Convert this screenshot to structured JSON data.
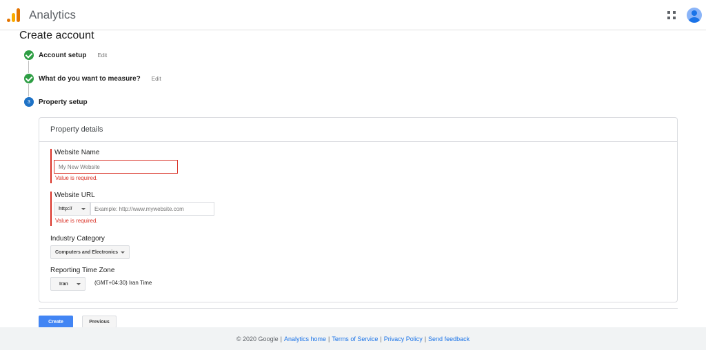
{
  "header": {
    "app_title": "Analytics",
    "logo_icon": "analytics-logo-icon",
    "apps_icon": "apps-grid-icon",
    "avatar_icon": "account-avatar-icon",
    "logo_colors": [
      "#e37400",
      "#f9ab00"
    ]
  },
  "page": {
    "title": "Create account"
  },
  "stepper": {
    "steps": [
      {
        "label": "Account setup",
        "edit": "Edit",
        "state": "complete"
      },
      {
        "label": "What do you want to measure?",
        "edit": "Edit",
        "state": "complete"
      },
      {
        "label": "Property setup",
        "number": "3",
        "state": "active"
      }
    ],
    "colors": {
      "complete": "#2e9e44",
      "active": "#1e72c6"
    }
  },
  "form": {
    "card_title": "Property details",
    "website_name": {
      "label": "Website Name",
      "placeholder": "My New Website",
      "error": "Value is required."
    },
    "website_url": {
      "label": "Website URL",
      "protocol": "http://",
      "placeholder": "Example: http://www.mywebsite.com",
      "error": "Value is required."
    },
    "industry": {
      "label": "Industry Category",
      "selected": "Computers and Electronics"
    },
    "timezone": {
      "label": "Reporting Time Zone",
      "country": "Iran",
      "zone_text": "(GMT+04:30) Iran Time"
    },
    "error_color": "#d93025"
  },
  "actions": {
    "create": "Create",
    "previous": "Previous",
    "primary_color": "#4285f4"
  },
  "footer": {
    "copyright": "© 2020 Google",
    "links": [
      "Analytics home",
      "Terms of Service",
      "Privacy Policy",
      "Send feedback"
    ],
    "separator": "|"
  }
}
